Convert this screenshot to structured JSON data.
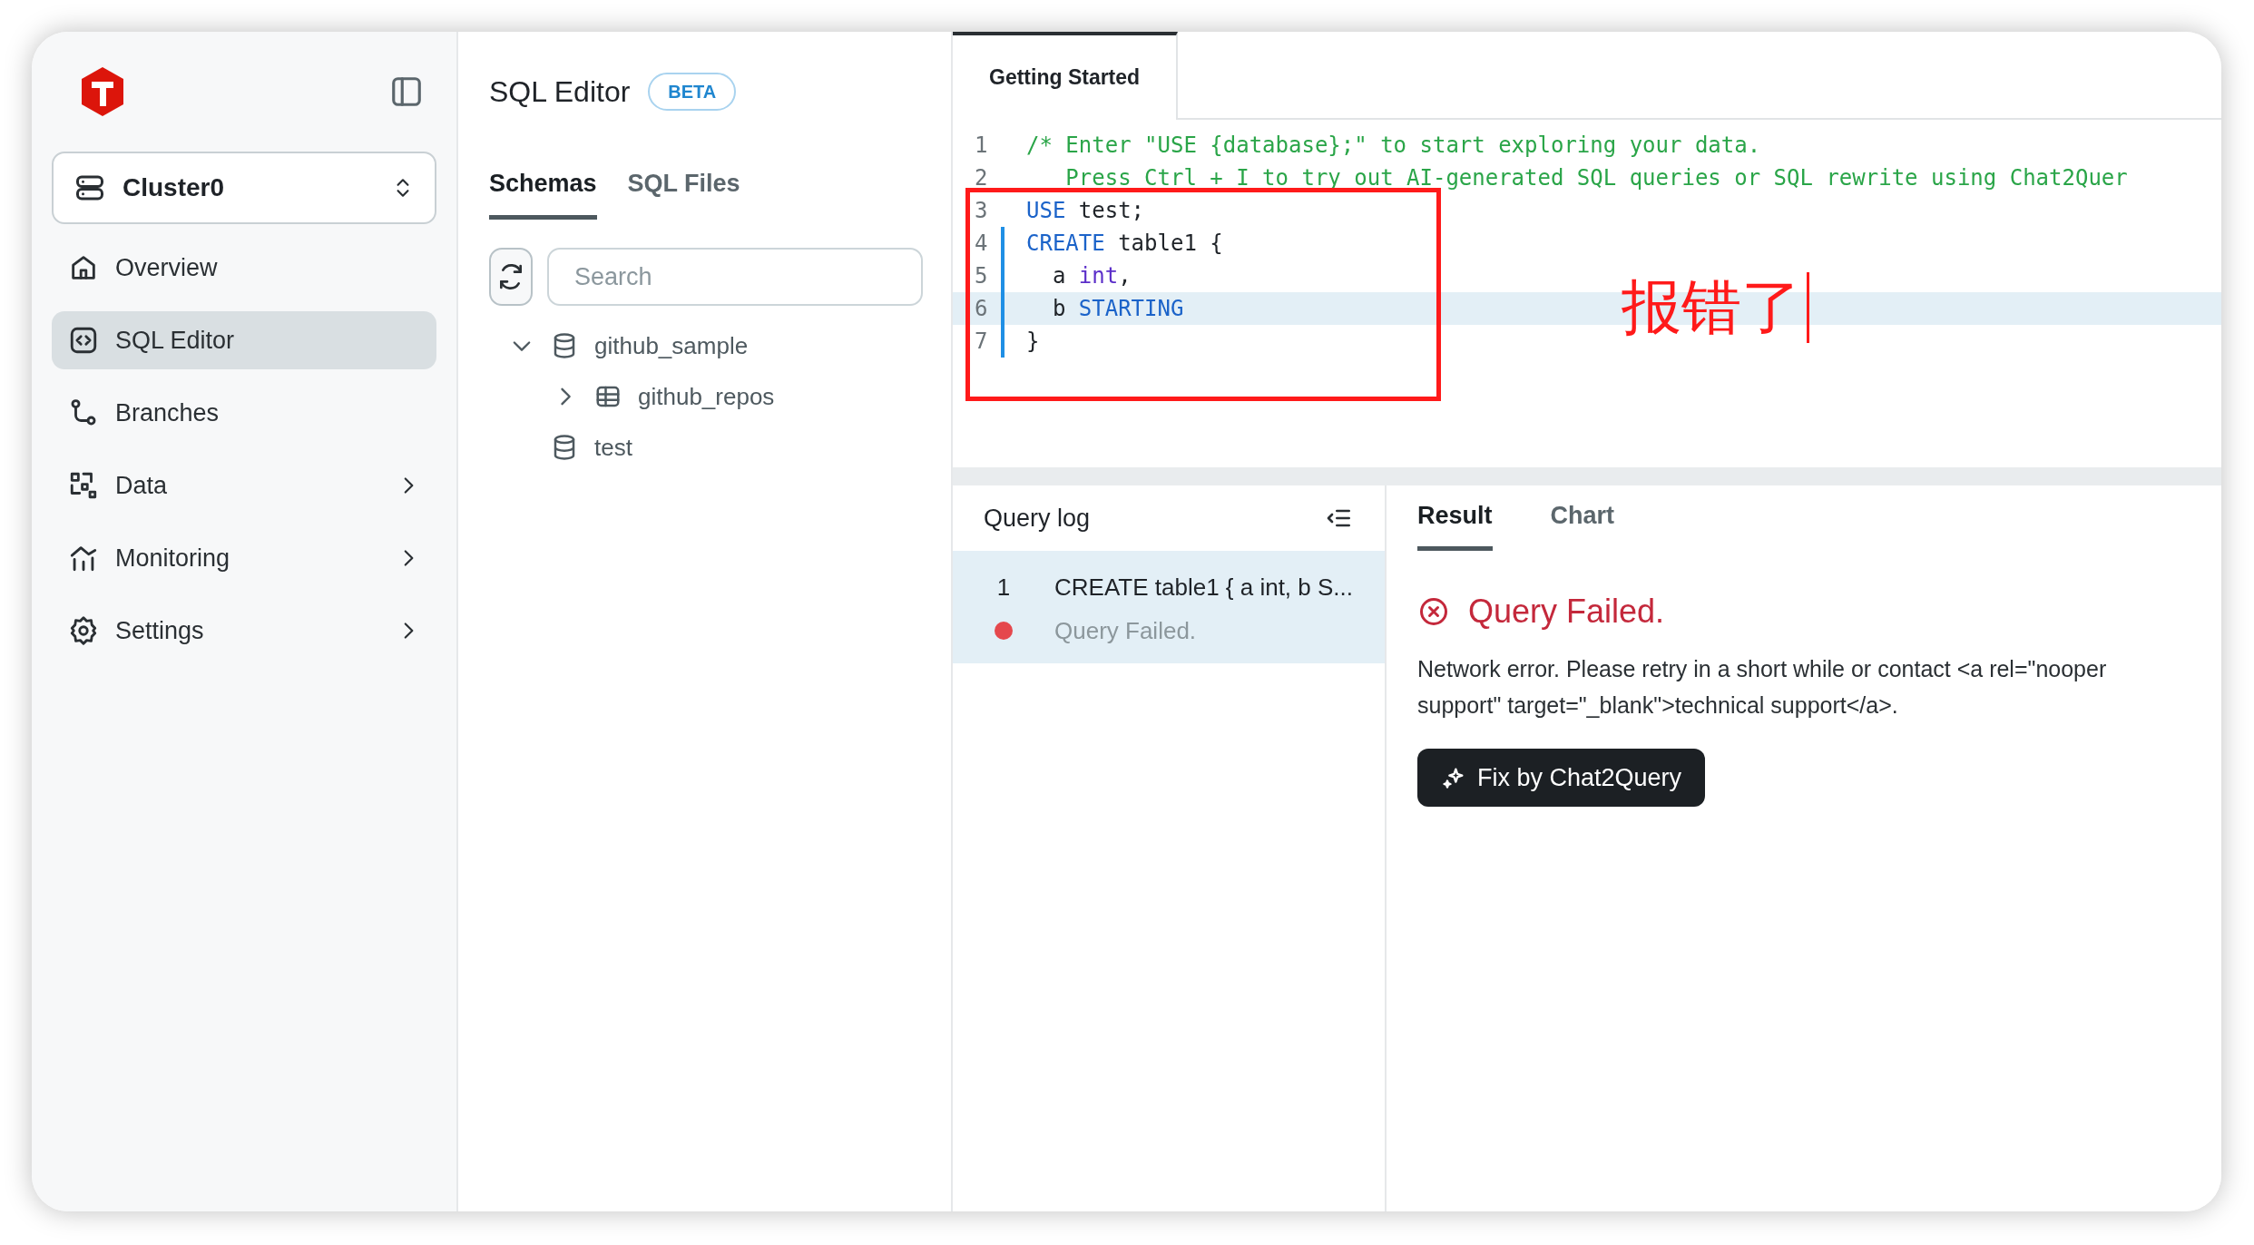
{
  "sidebar": {
    "cluster": "Cluster0",
    "items": [
      {
        "label": "Overview",
        "selected": false,
        "expandable": false
      },
      {
        "label": "SQL Editor",
        "selected": true,
        "expandable": false
      },
      {
        "label": "Branches",
        "selected": false,
        "expandable": false
      },
      {
        "label": "Data",
        "selected": false,
        "expandable": true
      },
      {
        "label": "Monitoring",
        "selected": false,
        "expandable": true
      },
      {
        "label": "Settings",
        "selected": false,
        "expandable": true
      }
    ]
  },
  "schemas_panel": {
    "title": "SQL Editor",
    "badge": "BETA",
    "tabs": [
      {
        "label": "Schemas",
        "selected": true
      },
      {
        "label": "SQL Files",
        "selected": false
      }
    ],
    "search": {
      "placeholder": "Search"
    },
    "tree": [
      {
        "label": "github_sample",
        "kind": "database",
        "expandable": true,
        "expanded": true,
        "children": [
          {
            "label": "github_repos",
            "kind": "table",
            "expandable": true,
            "expanded": false
          }
        ]
      },
      {
        "label": "test",
        "kind": "database",
        "expandable": false
      }
    ]
  },
  "editor": {
    "tabs": [
      {
        "label": "Getting Started",
        "selected": true
      }
    ],
    "lines": [
      {
        "number": "1",
        "active": false,
        "changed": false,
        "tokens": [
          {
            "kind": "comment",
            "text": "/* Enter \"USE {database};\" to start exploring your data."
          }
        ]
      },
      {
        "number": "2",
        "active": false,
        "changed": false,
        "tokens": [
          {
            "kind": "comment",
            "text": "   Press Ctrl + I to try out AI-generated SQL queries or SQL rewrite using Chat2Quer"
          }
        ]
      },
      {
        "number": "3",
        "active": false,
        "changed": false,
        "tokens": [
          {
            "kind": "keyword",
            "text": "USE"
          },
          {
            "kind": "plain",
            "text": " test;"
          }
        ]
      },
      {
        "number": "4",
        "active": false,
        "changed": true,
        "tokens": [
          {
            "kind": "keyword",
            "text": "CREATE"
          },
          {
            "kind": "plain",
            "text": " table1 {"
          }
        ]
      },
      {
        "number": "5",
        "active": false,
        "changed": true,
        "tokens": [
          {
            "kind": "plain",
            "text": "  a "
          },
          {
            "kind": "type",
            "text": "int"
          },
          {
            "kind": "plain",
            "text": ","
          }
        ]
      },
      {
        "number": "6",
        "active": true,
        "changed": true,
        "tokens": [
          {
            "kind": "plain",
            "text": "  b "
          },
          {
            "kind": "keyword",
            "text": "STARTING"
          }
        ]
      },
      {
        "number": "7",
        "active": false,
        "changed": true,
        "tokens": [
          {
            "kind": "plain",
            "text": "}"
          }
        ]
      }
    ],
    "annotation": {
      "text": "报错了"
    }
  },
  "query_log": {
    "title": "Query log",
    "entries": [
      {
        "number": "1",
        "query": "CREATE table1 { a int, b S...",
        "status": "Query Failed.",
        "color": "#e5484d",
        "selected": true
      }
    ]
  },
  "result": {
    "tabs": [
      {
        "label": "Result",
        "selected": true
      },
      {
        "label": "Chart",
        "selected": false
      }
    ],
    "error": {
      "title": "Query Failed.",
      "lines": [
        "Network error. Please retry in a short while or contact <a rel=\"nooper",
        "support\" target=\"_blank\">technical support</a>."
      ]
    },
    "fix_button": "Fix by Chat2Query"
  }
}
